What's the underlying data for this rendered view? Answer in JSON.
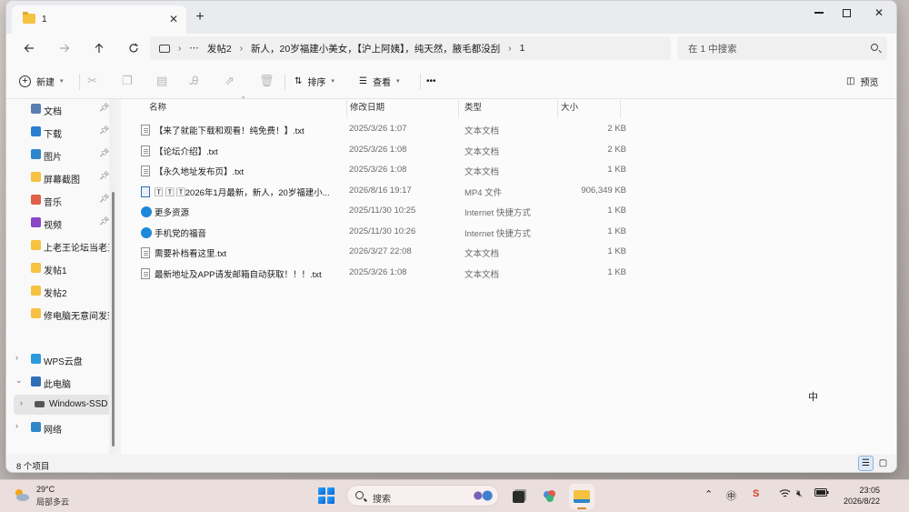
{
  "window": {
    "tab_title": "1",
    "close_symbol": "✕",
    "new_tab_symbol": "+"
  },
  "nav": {
    "breadcrumb": [
      "发帖2",
      "新人，20岁福建小美女，【沪上阿姨】，纯天然，腋毛都没刮",
      "1"
    ],
    "more": "⋯",
    "search_placeholder": "在 1 中搜索"
  },
  "toolbar": {
    "new_label": "新建",
    "sort_label": "排序",
    "view_label": "查看",
    "more_label": "•••",
    "preview_label": "预览"
  },
  "sidebar": {
    "quick": [
      {
        "label": "文档",
        "icon": "document-icon",
        "color": "#5a7fb0"
      },
      {
        "label": "下载",
        "icon": "download-icon",
        "color": "#2b7fd0"
      },
      {
        "label": "图片",
        "icon": "picture-icon",
        "color": "#2f86c9"
      },
      {
        "label": "屏幕截图",
        "icon": "folder-icon",
        "color": "#f5c242"
      },
      {
        "label": "音乐",
        "icon": "music-icon",
        "color": "#e0604a"
      },
      {
        "label": "视频",
        "icon": "video-icon",
        "color": "#8a47c4"
      },
      {
        "label": "上老王论坛当老王",
        "icon": "folder-icon",
        "color": "#f5c242"
      },
      {
        "label": "发帖1",
        "icon": "folder-icon",
        "color": "#f5c242"
      },
      {
        "label": "发帖2",
        "icon": "folder-icon",
        "color": "#f5c242"
      },
      {
        "label": "修电脑无意间发现",
        "icon": "folder-icon",
        "color": "#f5c242"
      }
    ],
    "tree": [
      {
        "label": "WPS云盘",
        "icon": "cloud-icon"
      },
      {
        "label": "此电脑",
        "icon": "pc-icon"
      },
      {
        "label": "Windows-SSD",
        "icon": "drive-icon"
      },
      {
        "label": "网络",
        "icon": "network-icon"
      }
    ]
  },
  "columns": {
    "name": "名称",
    "date": "修改日期",
    "type": "类型",
    "size": "大小"
  },
  "files": [
    {
      "name": "【来了就能下载和观看！纯免费！】.txt",
      "date": "2025/3/26 1:07",
      "type": "文本文档",
      "size": "2 KB",
      "icon": "doc"
    },
    {
      "name": "【论坛介绍】.txt",
      "date": "2025/3/26 1:08",
      "type": "文本文档",
      "size": "2 KB",
      "icon": "doc"
    },
    {
      "name": "【永久地址发布页】.txt",
      "date": "2025/3/26 1:08",
      "type": "文本文档",
      "size": "1 KB",
      "icon": "doc"
    },
    {
      "name": "🅃 🅃 🅃2026年1月最新，新人，20岁福建小...",
      "date": "2026/8/16 19:17",
      "type": "MP4 文件",
      "size": "906,349 KB",
      "icon": "mp4"
    },
    {
      "name": "更多资源",
      "date": "2025/11/30 10:25",
      "type": "Internet 快捷方式",
      "size": "1 KB",
      "icon": "web"
    },
    {
      "name": "手机党的福音",
      "date": "2025/11/30 10:26",
      "type": "Internet 快捷方式",
      "size": "1 KB",
      "icon": "web"
    },
    {
      "name": "需要补档看这里.txt",
      "date": "2026/3/27 22:08",
      "type": "文本文档",
      "size": "1 KB",
      "icon": "doc"
    },
    {
      "name": "最新地址及APP请发邮箱自动获取！！！.txt",
      "date": "2025/3/26 1:08",
      "type": "文本文档",
      "size": "1 KB",
      "icon": "doc"
    }
  ],
  "status": {
    "count": "8 个项目"
  },
  "taskbar": {
    "temp": "29°C",
    "weather": "局部多云",
    "search_label": "搜索",
    "ime": "中",
    "time": "23:05",
    "date": "2026/8/22"
  }
}
